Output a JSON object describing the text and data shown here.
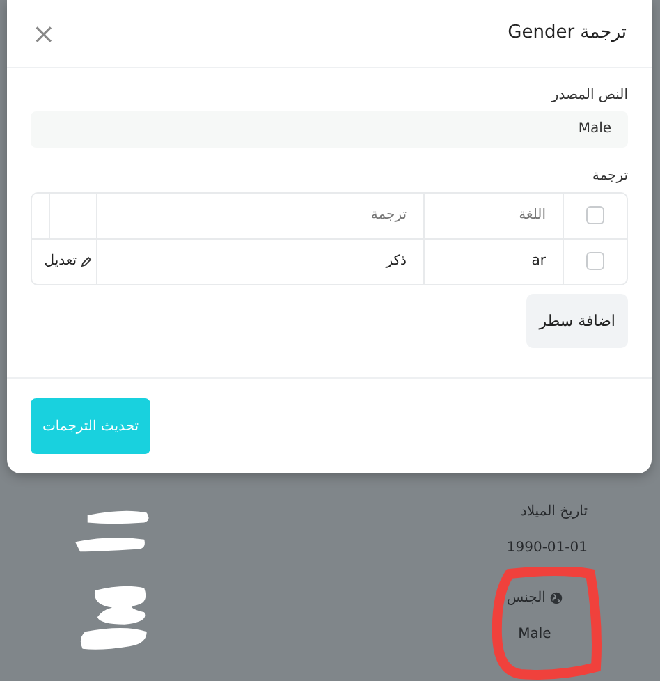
{
  "dialog": {
    "title": "ترجمة Gender",
    "close": "×",
    "source_label": "النص المصدر",
    "source_value": "Male",
    "translations_label": "ترجمة",
    "table": {
      "header_checked": false,
      "columns": [
        "اللغة",
        "ترجمة"
      ],
      "rows": [
        {
          "checked": false,
          "language": "ar",
          "translation": "ذكر",
          "action": "تعديل"
        }
      ]
    },
    "add_row_button": "اضافة سطر",
    "submit_button": "تحديث الترجمات"
  },
  "background": {
    "fields": [
      {
        "label": "تاريخ الميلاد",
        "value": "1990-01-01",
        "globe": false
      },
      {
        "label": "الجنس",
        "value": "Male",
        "globe": true
      }
    ]
  }
}
